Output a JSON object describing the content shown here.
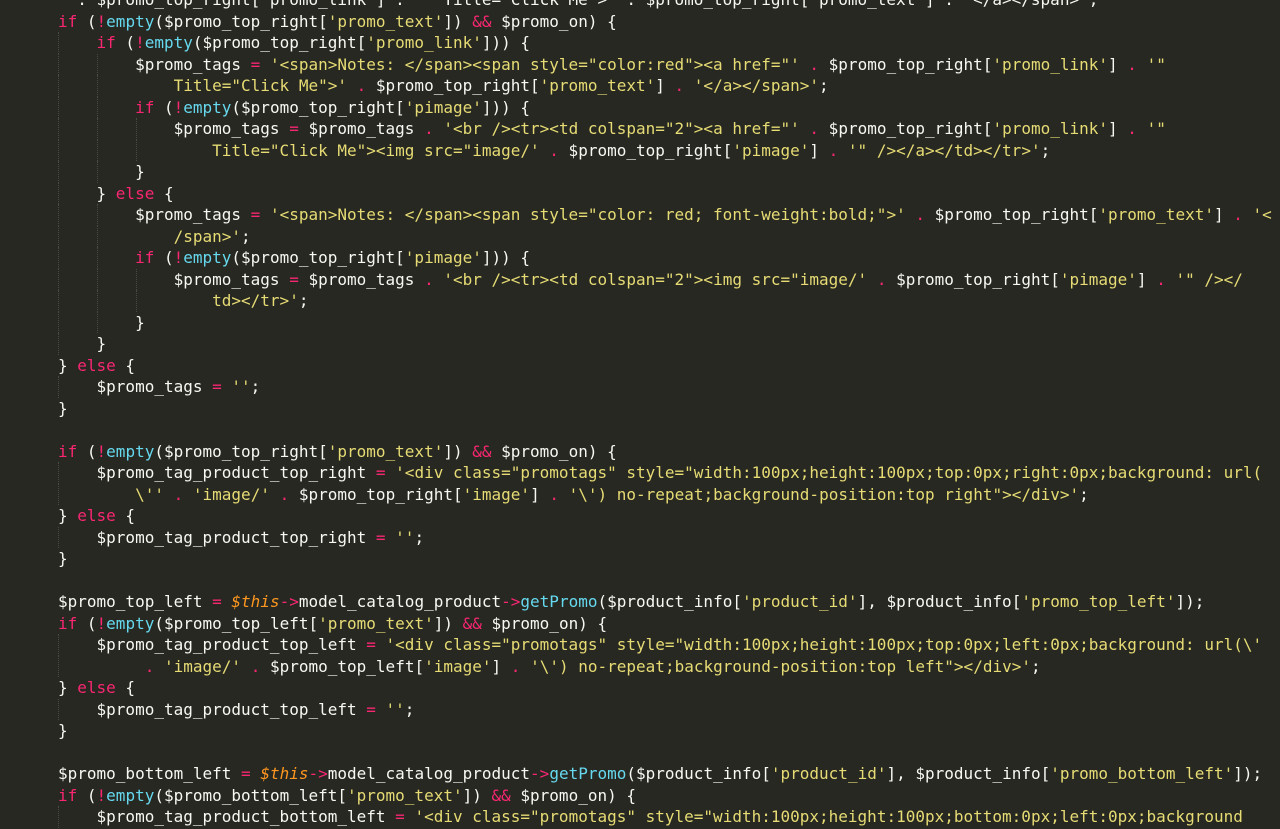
{
  "editor": {
    "theme": "monokai",
    "colors": {
      "background": "#272822",
      "plain": "#f8f8f2",
      "keyword": "#f92672",
      "function": "#66d9ef",
      "string": "#e6db74",
      "variable": "#fd971f"
    },
    "lines": [
      {
        "indent": 0,
        "guides": 0,
        "tokens": [
          [
            "pl",
            "\" . $promo_top_right['promo_link'] . \"\" Title=\"Click Me\">' . $promo_top_right['promo_text'] . '</a></span>';"
          ]
        ]
      },
      {
        "indent": 0,
        "guides": 0,
        "tokens": [
          [
            "kw",
            "if"
          ],
          [
            "pl",
            " ("
          ],
          [
            "kw",
            "!"
          ],
          [
            "fn",
            "empty"
          ],
          [
            "pl",
            "($promo_top_right["
          ],
          [
            "str",
            "'promo_text'"
          ],
          [
            "pl",
            "]) "
          ],
          [
            "kw",
            "&&"
          ],
          [
            "pl",
            " $promo_on) {"
          ]
        ]
      },
      {
        "indent": 4,
        "guides": 1,
        "tokens": [
          [
            "kw",
            "if"
          ],
          [
            "pl",
            " ("
          ],
          [
            "kw",
            "!"
          ],
          [
            "fn",
            "empty"
          ],
          [
            "pl",
            "($promo_top_right["
          ],
          [
            "str",
            "'promo_link'"
          ],
          [
            "pl",
            "])) {"
          ]
        ]
      },
      {
        "indent": 8,
        "guides": 2,
        "tokens": [
          [
            "pl",
            "$promo_tags "
          ],
          [
            "kw",
            "="
          ],
          [
            "pl",
            " "
          ],
          [
            "str",
            "'<span>Notes: </span><span style=\"color:red\"><a href=\"'"
          ],
          [
            "pl",
            " "
          ],
          [
            "kw",
            "."
          ],
          [
            "pl",
            " $promo_top_right["
          ],
          [
            "str",
            "'promo_link'"
          ],
          [
            "pl",
            "] "
          ],
          [
            "kw",
            "."
          ],
          [
            "pl",
            " "
          ],
          [
            "str",
            "'\""
          ]
        ]
      },
      {
        "indent": 12,
        "guides": 2,
        "tokens": [
          [
            "str",
            "Title=\"Click Me\">'"
          ],
          [
            "pl",
            " "
          ],
          [
            "kw",
            "."
          ],
          [
            "pl",
            " $promo_top_right["
          ],
          [
            "str",
            "'promo_text'"
          ],
          [
            "pl",
            "] "
          ],
          [
            "kw",
            "."
          ],
          [
            "pl",
            " "
          ],
          [
            "str",
            "'</a></span>'"
          ],
          [
            "pl",
            ";"
          ]
        ]
      },
      {
        "indent": 8,
        "guides": 2,
        "tokens": [
          [
            "kw",
            "if"
          ],
          [
            "pl",
            " ("
          ],
          [
            "kw",
            "!"
          ],
          [
            "fn",
            "empty"
          ],
          [
            "pl",
            "($promo_top_right["
          ],
          [
            "str",
            "'pimage'"
          ],
          [
            "pl",
            "])) {"
          ]
        ]
      },
      {
        "indent": 12,
        "guides": 3,
        "tokens": [
          [
            "pl",
            "$promo_tags "
          ],
          [
            "kw",
            "="
          ],
          [
            "pl",
            " $promo_tags "
          ],
          [
            "kw",
            "."
          ],
          [
            "pl",
            " "
          ],
          [
            "str",
            "'<br /><tr><td colspan=\"2\"><a href=\"'"
          ],
          [
            "pl",
            " "
          ],
          [
            "kw",
            "."
          ],
          [
            "pl",
            " $promo_top_right["
          ],
          [
            "str",
            "'promo_link'"
          ],
          [
            "pl",
            "] "
          ],
          [
            "kw",
            "."
          ],
          [
            "pl",
            " "
          ],
          [
            "str",
            "'\""
          ]
        ]
      },
      {
        "indent": 16,
        "guides": 3,
        "tokens": [
          [
            "str",
            "Title=\"Click Me\"><img src=\"image/'"
          ],
          [
            "pl",
            " "
          ],
          [
            "kw",
            "."
          ],
          [
            "pl",
            " $promo_top_right["
          ],
          [
            "str",
            "'pimage'"
          ],
          [
            "pl",
            "] "
          ],
          [
            "kw",
            "."
          ],
          [
            "pl",
            " "
          ],
          [
            "str",
            "'\" /></a></td></tr>'"
          ],
          [
            "pl",
            ";"
          ]
        ]
      },
      {
        "indent": 8,
        "guides": 2,
        "tokens": [
          [
            "pl",
            "}"
          ]
        ]
      },
      {
        "indent": 4,
        "guides": 1,
        "tokens": [
          [
            "pl",
            "} "
          ],
          [
            "kw",
            "else"
          ],
          [
            "pl",
            " {"
          ]
        ]
      },
      {
        "indent": 8,
        "guides": 2,
        "tokens": [
          [
            "pl",
            "$promo_tags "
          ],
          [
            "kw",
            "="
          ],
          [
            "pl",
            " "
          ],
          [
            "str",
            "'<span>Notes: </span><span style=\"color: red; font-weight:bold;\">'"
          ],
          [
            "pl",
            " "
          ],
          [
            "kw",
            "."
          ],
          [
            "pl",
            " $promo_top_right["
          ],
          [
            "str",
            "'promo_text'"
          ],
          [
            "pl",
            "] "
          ],
          [
            "kw",
            "."
          ],
          [
            "pl",
            " "
          ],
          [
            "str",
            "'<"
          ]
        ]
      },
      {
        "indent": 12,
        "guides": 2,
        "tokens": [
          [
            "str",
            "/span>'"
          ],
          [
            "pl",
            ";"
          ]
        ]
      },
      {
        "indent": 8,
        "guides": 2,
        "tokens": [
          [
            "kw",
            "if"
          ],
          [
            "pl",
            " ("
          ],
          [
            "kw",
            "!"
          ],
          [
            "fn",
            "empty"
          ],
          [
            "pl",
            "($promo_top_right["
          ],
          [
            "str",
            "'pimage'"
          ],
          [
            "pl",
            "])) {"
          ]
        ]
      },
      {
        "indent": 12,
        "guides": 3,
        "tokens": [
          [
            "pl",
            "$promo_tags "
          ],
          [
            "kw",
            "="
          ],
          [
            "pl",
            " $promo_tags "
          ],
          [
            "kw",
            "."
          ],
          [
            "pl",
            " "
          ],
          [
            "str",
            "'<br /><tr><td colspan=\"2\"><img src=\"image/'"
          ],
          [
            "pl",
            " "
          ],
          [
            "kw",
            "."
          ],
          [
            "pl",
            " $promo_top_right["
          ],
          [
            "str",
            "'pimage'"
          ],
          [
            "pl",
            "] "
          ],
          [
            "kw",
            "."
          ],
          [
            "pl",
            " "
          ],
          [
            "str",
            "'\" /></"
          ]
        ]
      },
      {
        "indent": 16,
        "guides": 3,
        "tokens": [
          [
            "str",
            "td></tr>'"
          ],
          [
            "pl",
            ";"
          ]
        ]
      },
      {
        "indent": 8,
        "guides": 2,
        "tokens": [
          [
            "pl",
            "}"
          ]
        ]
      },
      {
        "indent": 4,
        "guides": 1,
        "tokens": [
          [
            "pl",
            "}"
          ]
        ]
      },
      {
        "indent": 0,
        "guides": 0,
        "tokens": [
          [
            "pl",
            "} "
          ],
          [
            "kw",
            "else"
          ],
          [
            "pl",
            " {"
          ]
        ]
      },
      {
        "indent": 4,
        "guides": 1,
        "tokens": [
          [
            "pl",
            "$promo_tags "
          ],
          [
            "kw",
            "="
          ],
          [
            "pl",
            " "
          ],
          [
            "str",
            "''"
          ],
          [
            "pl",
            ";"
          ]
        ]
      },
      {
        "indent": 0,
        "guides": 0,
        "tokens": [
          [
            "pl",
            "}"
          ]
        ]
      },
      {
        "indent": 0,
        "guides": 0,
        "tokens": []
      },
      {
        "indent": 0,
        "guides": 0,
        "tokens": [
          [
            "kw",
            "if"
          ],
          [
            "pl",
            " ("
          ],
          [
            "kw",
            "!"
          ],
          [
            "fn",
            "empty"
          ],
          [
            "pl",
            "($promo_top_right["
          ],
          [
            "str",
            "'promo_text'"
          ],
          [
            "pl",
            "]) "
          ],
          [
            "kw",
            "&&"
          ],
          [
            "pl",
            " $promo_on) {"
          ]
        ]
      },
      {
        "indent": 4,
        "guides": 1,
        "tokens": [
          [
            "pl",
            "$promo_tag_product_top_right "
          ],
          [
            "kw",
            "="
          ],
          [
            "pl",
            " "
          ],
          [
            "str",
            "'<div class=\"promotags\" style=\"width:100px;height:100px;top:0px;right:0px;background: url("
          ]
        ]
      },
      {
        "indent": 8,
        "guides": 1,
        "tokens": [
          [
            "str",
            "\\''"
          ],
          [
            "pl",
            " "
          ],
          [
            "kw",
            "."
          ],
          [
            "pl",
            " "
          ],
          [
            "str",
            "'image/'"
          ],
          [
            "pl",
            " "
          ],
          [
            "kw",
            "."
          ],
          [
            "pl",
            " $promo_top_right["
          ],
          [
            "str",
            "'image'"
          ],
          [
            "pl",
            "] "
          ],
          [
            "kw",
            "."
          ],
          [
            "pl",
            " "
          ],
          [
            "str",
            "'\\') no-repeat;background-position:top right\"></div>'"
          ],
          [
            "pl",
            ";"
          ]
        ]
      },
      {
        "indent": 0,
        "guides": 0,
        "tokens": [
          [
            "pl",
            "} "
          ],
          [
            "kw",
            "else"
          ],
          [
            "pl",
            " {"
          ]
        ]
      },
      {
        "indent": 4,
        "guides": 1,
        "tokens": [
          [
            "pl",
            "$promo_tag_product_top_right "
          ],
          [
            "kw",
            "="
          ],
          [
            "pl",
            " "
          ],
          [
            "str",
            "''"
          ],
          [
            "pl",
            ";"
          ]
        ]
      },
      {
        "indent": 0,
        "guides": 0,
        "tokens": [
          [
            "pl",
            "}"
          ]
        ]
      },
      {
        "indent": 0,
        "guides": 0,
        "tokens": []
      },
      {
        "indent": 0,
        "guides": 0,
        "tokens": [
          [
            "pl",
            "$promo_top_left "
          ],
          [
            "kw",
            "="
          ],
          [
            "pl",
            " "
          ],
          [
            "var",
            "$this"
          ],
          [
            "kw",
            "->"
          ],
          [
            "pl",
            "model_catalog_product"
          ],
          [
            "kw",
            "->"
          ],
          [
            "fn",
            "getPromo"
          ],
          [
            "pl",
            "($product_info["
          ],
          [
            "str",
            "'product_id'"
          ],
          [
            "pl",
            "], $product_info["
          ],
          [
            "str",
            "'promo_top_left'"
          ],
          [
            "pl",
            "]);"
          ]
        ]
      },
      {
        "indent": 0,
        "guides": 0,
        "tokens": [
          [
            "kw",
            "if"
          ],
          [
            "pl",
            " ("
          ],
          [
            "kw",
            "!"
          ],
          [
            "fn",
            "empty"
          ],
          [
            "pl",
            "($promo_top_left["
          ],
          [
            "str",
            "'promo_text'"
          ],
          [
            "pl",
            "]) "
          ],
          [
            "kw",
            "&&"
          ],
          [
            "pl",
            " $promo_on) {"
          ]
        ]
      },
      {
        "indent": 4,
        "guides": 1,
        "tokens": [
          [
            "pl",
            "$promo_tag_product_top_left "
          ],
          [
            "kw",
            "="
          ],
          [
            "pl",
            " "
          ],
          [
            "str",
            "'<div class=\"promotags\" style=\"width:100px;height:100px;top:0px;left:0px;background: url(\\'"
          ]
        ]
      },
      {
        "indent": 8,
        "guides": 1,
        "tokens": [
          [
            "pl",
            " "
          ],
          [
            "kw",
            "."
          ],
          [
            "pl",
            " "
          ],
          [
            "str",
            "'image/'"
          ],
          [
            "pl",
            " "
          ],
          [
            "kw",
            "."
          ],
          [
            "pl",
            " $promo_top_left["
          ],
          [
            "str",
            "'image'"
          ],
          [
            "pl",
            "] "
          ],
          [
            "kw",
            "."
          ],
          [
            "pl",
            " "
          ],
          [
            "str",
            "'\\') no-repeat;background-position:top left\"></div>'"
          ],
          [
            "pl",
            ";"
          ]
        ]
      },
      {
        "indent": 0,
        "guides": 0,
        "tokens": [
          [
            "pl",
            "} "
          ],
          [
            "kw",
            "else"
          ],
          [
            "pl",
            " {"
          ]
        ]
      },
      {
        "indent": 4,
        "guides": 1,
        "tokens": [
          [
            "pl",
            "$promo_tag_product_top_left "
          ],
          [
            "kw",
            "="
          ],
          [
            "pl",
            " "
          ],
          [
            "str",
            "''"
          ],
          [
            "pl",
            ";"
          ]
        ]
      },
      {
        "indent": 0,
        "guides": 0,
        "tokens": [
          [
            "pl",
            "}"
          ]
        ]
      },
      {
        "indent": 0,
        "guides": 0,
        "tokens": []
      },
      {
        "indent": 0,
        "guides": 0,
        "tokens": [
          [
            "pl",
            "$promo_bottom_left "
          ],
          [
            "kw",
            "="
          ],
          [
            "pl",
            " "
          ],
          [
            "var",
            "$this"
          ],
          [
            "kw",
            "->"
          ],
          [
            "pl",
            "model_catalog_product"
          ],
          [
            "kw",
            "->"
          ],
          [
            "fn",
            "getPromo"
          ],
          [
            "pl",
            "($product_info["
          ],
          [
            "str",
            "'product_id'"
          ],
          [
            "pl",
            "], $product_info["
          ],
          [
            "str",
            "'promo_bottom_left'"
          ],
          [
            "pl",
            "]);"
          ]
        ]
      },
      {
        "indent": 0,
        "guides": 0,
        "tokens": [
          [
            "kw",
            "if"
          ],
          [
            "pl",
            " ("
          ],
          [
            "kw",
            "!"
          ],
          [
            "fn",
            "empty"
          ],
          [
            "pl",
            "($promo_bottom_left["
          ],
          [
            "str",
            "'promo_text'"
          ],
          [
            "pl",
            "]) "
          ],
          [
            "kw",
            "&&"
          ],
          [
            "pl",
            " $promo_on) {"
          ]
        ]
      },
      {
        "indent": 4,
        "guides": 1,
        "tokens": [
          [
            "pl",
            "$promo_tag_product_bottom_left "
          ],
          [
            "kw",
            "="
          ],
          [
            "pl",
            " "
          ],
          [
            "str",
            "'<div class=\"promotags\" style=\"width:100px;height:100px;bottom:0px;left:0px;background"
          ]
        ]
      }
    ]
  }
}
